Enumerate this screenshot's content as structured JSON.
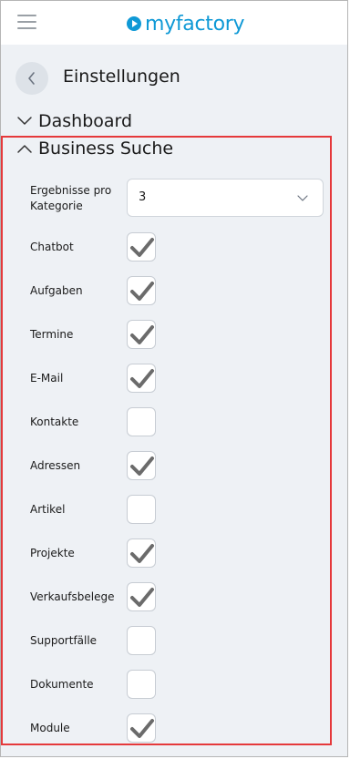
{
  "header": {
    "logo_text": "myfactory",
    "brand_color": "#0f99d6"
  },
  "page": {
    "title": "Einstellungen"
  },
  "sections": {
    "dashboard": {
      "label": "Dashboard",
      "expanded": false
    },
    "business_search": {
      "label": "Business Suche",
      "expanded": true
    }
  },
  "results_per_category": {
    "label": "Ergebnisse pro Kategorie",
    "value": "3"
  },
  "checkboxes": [
    {
      "label": "Chatbot",
      "checked": true
    },
    {
      "label": "Aufgaben",
      "checked": true
    },
    {
      "label": "Termine",
      "checked": true
    },
    {
      "label": "E-Mail",
      "checked": true
    },
    {
      "label": "Kontakte",
      "checked": false
    },
    {
      "label": "Adressen",
      "checked": true
    },
    {
      "label": "Artikel",
      "checked": false
    },
    {
      "label": "Projekte",
      "checked": true
    },
    {
      "label": "Verkaufsbelege",
      "checked": true
    },
    {
      "label": "Supportfälle",
      "checked": false
    },
    {
      "label": "Dokumente",
      "checked": false
    },
    {
      "label": "Module",
      "checked": true
    }
  ],
  "colors": {
    "highlight_border": "#e5393b",
    "checkmark": "#6b6b6b",
    "panel_bg": "#eef1f5"
  },
  "icons": [
    "hamburger-menu-icon",
    "play-logo-icon",
    "chevron-left-icon",
    "chevron-down-icon",
    "chevron-up-icon",
    "checkmark-icon"
  ]
}
